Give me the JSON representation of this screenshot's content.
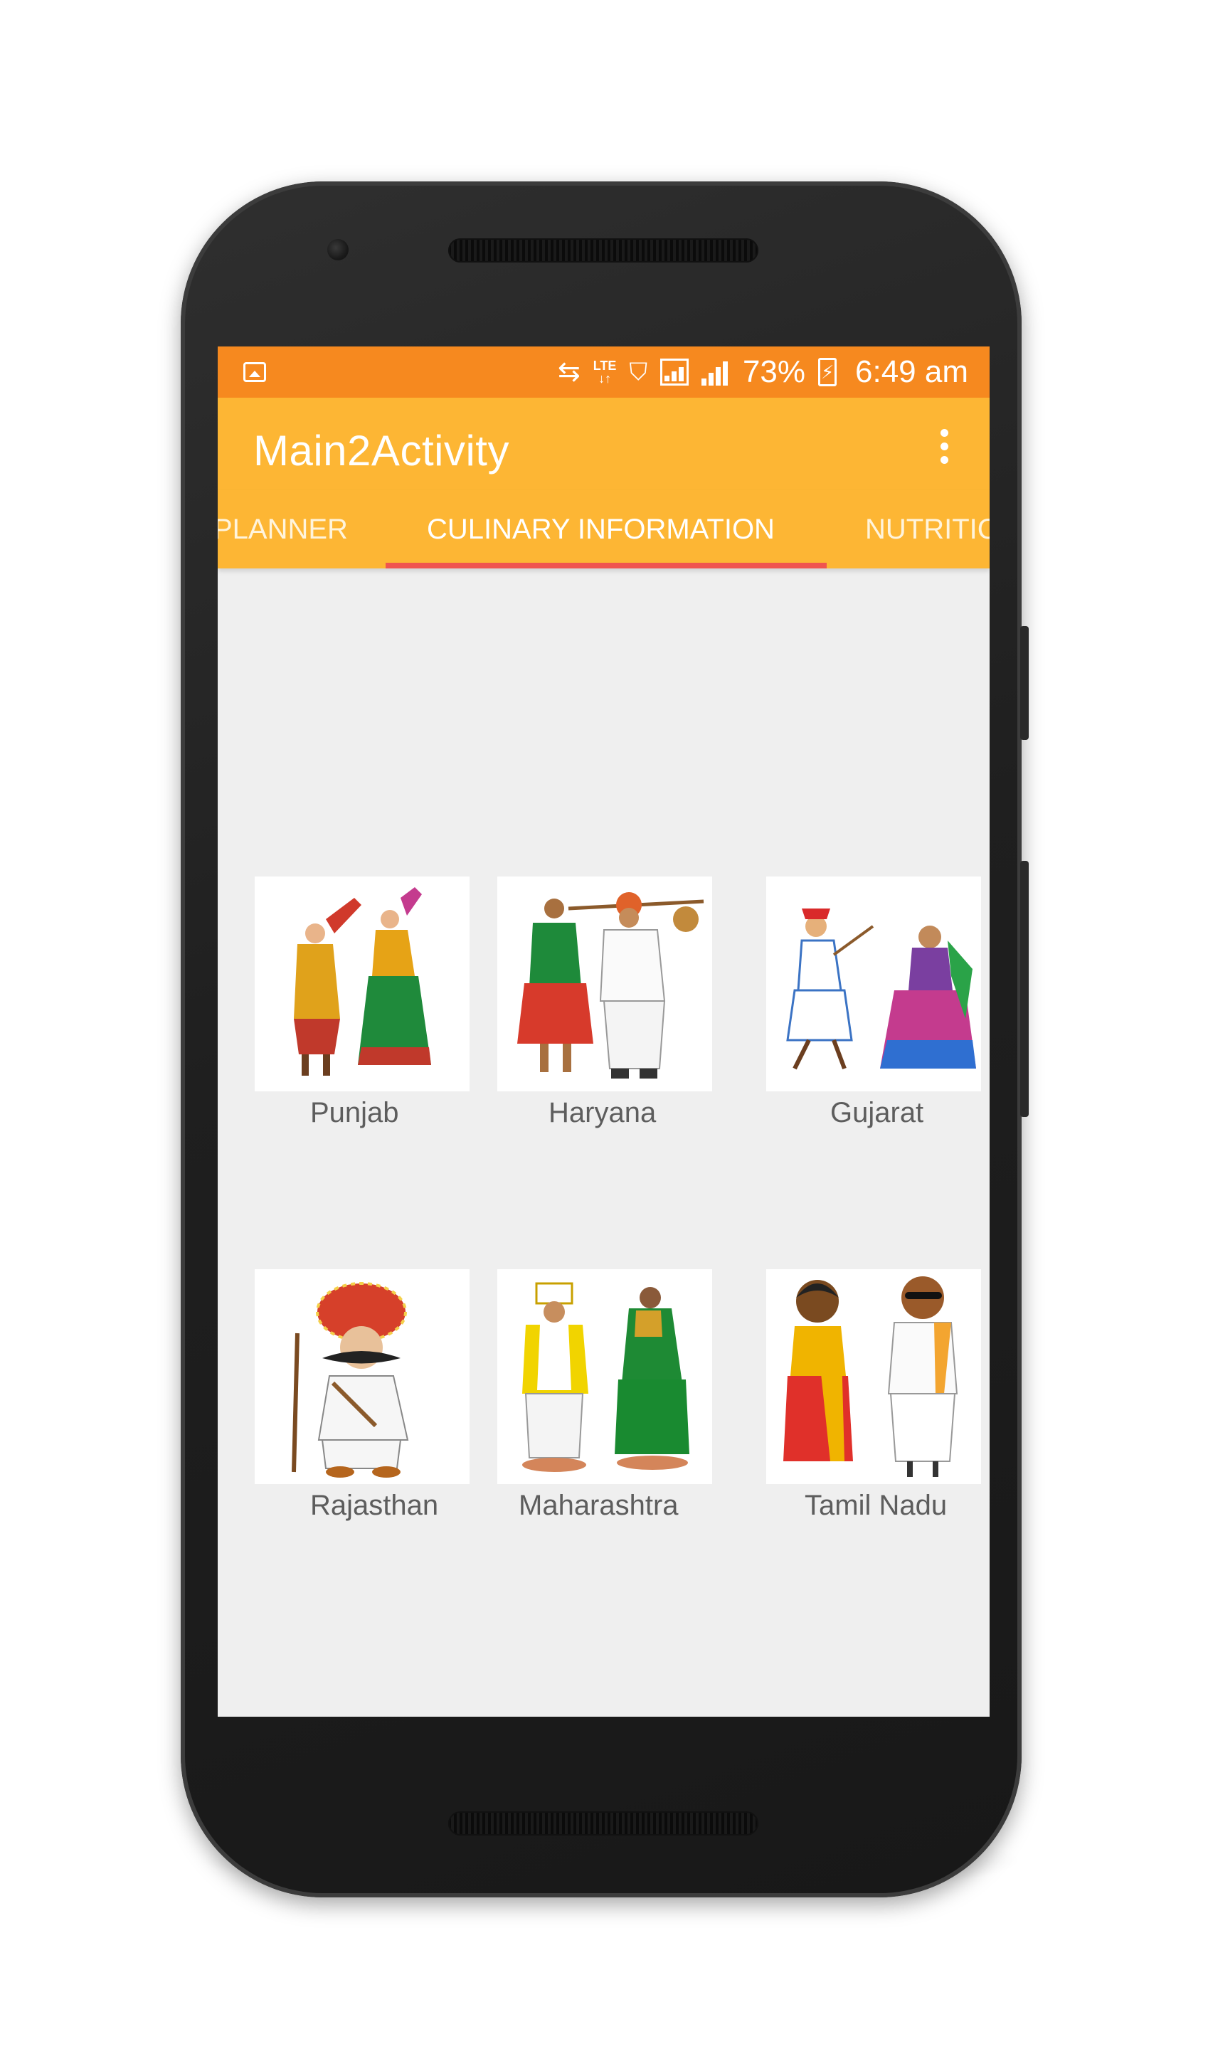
{
  "status_bar": {
    "battery": "73%",
    "time": "6:49 am",
    "network": "LTE"
  },
  "app_bar": {
    "title": "Main2Activity",
    "overflow_icon": "more-vert-icon"
  },
  "tabs": [
    {
      "label": "PLANNER",
      "active": false
    },
    {
      "label": "CULINARY INFORMATION",
      "active": true
    },
    {
      "label": "NUTRITIC",
      "active": false
    }
  ],
  "states": [
    {
      "name": "Punjab"
    },
    {
      "name": "Haryana"
    },
    {
      "name": "Gujarat"
    },
    {
      "name": "Rajasthan"
    },
    {
      "name": "Maharashtra"
    },
    {
      "name": "Tamil Nadu"
    }
  ],
  "colors": {
    "status_bar": "#f6891f",
    "app_bar": "#fdb634",
    "tab_indicator": "#f0544f",
    "background": "#efefef"
  }
}
